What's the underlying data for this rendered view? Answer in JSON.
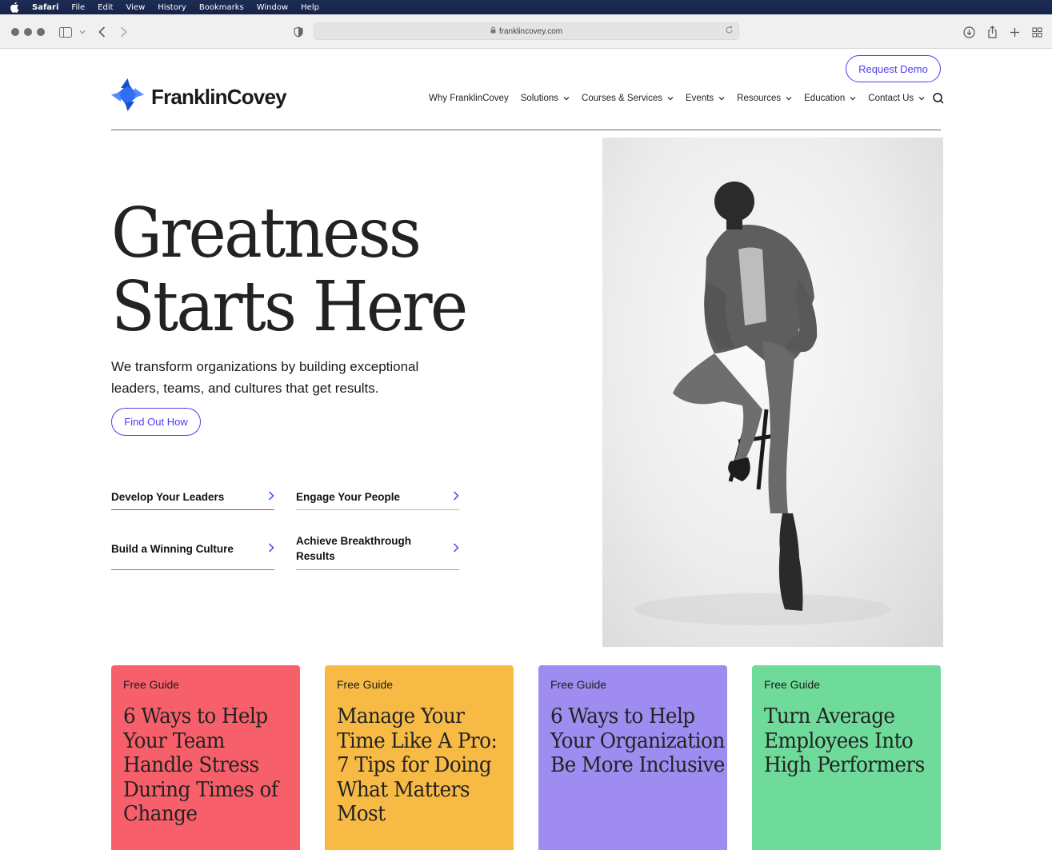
{
  "menubar": {
    "items": [
      "Safari",
      "File",
      "Edit",
      "View",
      "History",
      "Bookmarks",
      "Window",
      "Help"
    ]
  },
  "browser": {
    "url": "franklincovey.com"
  },
  "header": {
    "logo_text": "FranklinCovey",
    "request_demo": "Request Demo",
    "nav": [
      {
        "label": "Why FranklinCovey",
        "has_dropdown": false
      },
      {
        "label": "Solutions",
        "has_dropdown": true
      },
      {
        "label": "Courses & Services",
        "has_dropdown": true
      },
      {
        "label": "Events",
        "has_dropdown": true
      },
      {
        "label": "Resources",
        "has_dropdown": true
      },
      {
        "label": "Education",
        "has_dropdown": true
      },
      {
        "label": "Contact Us",
        "has_dropdown": true
      }
    ]
  },
  "hero": {
    "title_line1": "Greatness",
    "title_line2": "Starts Here",
    "subtitle": "We transform organizations by building exceptional leaders, teams, and cultures that get results.",
    "cta": "Find Out How",
    "quick_links": [
      {
        "label": "Develop Your Leaders",
        "color": "#e3344f"
      },
      {
        "label": "Engage Your People",
        "color": "#f5b335"
      },
      {
        "label": "Build a Winning Culture",
        "color": "#7b6cf0"
      },
      {
        "label": "Achieve Breakthrough Results",
        "color": "#3fcf7f"
      }
    ]
  },
  "cards": [
    {
      "kicker": "Free Guide",
      "title": "6 Ways to Help Your Team Handle Stress During Times of Change",
      "color": "#f7606a"
    },
    {
      "kicker": "Free Guide",
      "title": "Manage Your Time Like A Pro: 7 Tips for Doing What Matters Most",
      "color": "#f7bb45"
    },
    {
      "kicker": "Free Guide",
      "title": "6 Ways to Help Your Organization Be More Inclusive",
      "color": "#9f8cf0"
    },
    {
      "kicker": "Free Guide",
      "title": "Turn Average Employees Into High Performers",
      "color": "#6fdb9a"
    }
  ],
  "colors": {
    "accent": "#4c3ef0",
    "logo_blue": "#2f6ef2"
  }
}
